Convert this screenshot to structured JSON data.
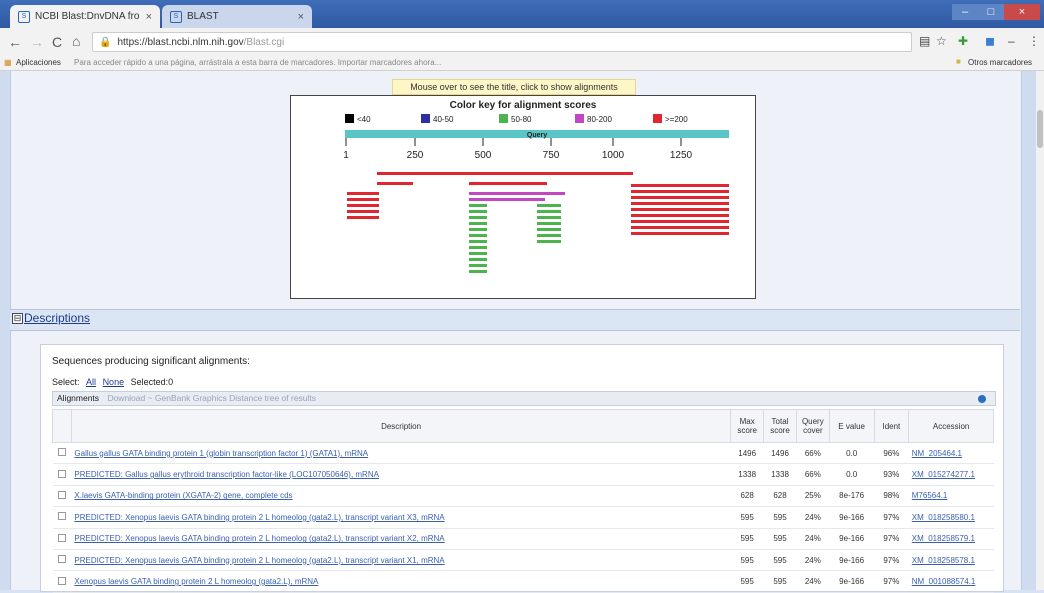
{
  "browser": {
    "tabs": [
      {
        "label": "NCBI Blast:DnvDNA fro"
      },
      {
        "label": "BLAST"
      }
    ],
    "url": "https://blast.ncbi.nlm.nih.gov",
    "url_path": "/Blast.cgi",
    "bookmarks_label": "Aplicaciones",
    "bookmarks_hint": "Para acceder rápido a una página, arrástrala a esta barra de marcadores. Importar marcadores ahora...",
    "other_bookmarks": "Otros marcadores"
  },
  "graphic": {
    "hint": "Mouse over to see the title, click to show alignments",
    "color_key_title": "Color key for alignment scores",
    "key": [
      {
        "label": "<40",
        "color": "#000000"
      },
      {
        "label": "40-50",
        "color": "#2e2ea0"
      },
      {
        "label": "50-80",
        "color": "#4db34d"
      },
      {
        "label": "80-200",
        "color": "#c347c3"
      },
      {
        "label": ">=200",
        "color": "#e0262e"
      }
    ],
    "query_label": "Query",
    "query_color": "#5bc4c4",
    "ticks": [
      "1",
      "250",
      "500",
      "750",
      "1000",
      "1250"
    ]
  },
  "descriptions": {
    "header": "Descriptions",
    "toggle": "⊟",
    "seq_title": "Sequences producing significant alignments:",
    "select_label": "Select:",
    "all_label": "All",
    "none_label": "None",
    "selected_label": "Selected:0",
    "alignments_label": "Alignments",
    "download_label": "Download ~ GenBank Graphics Distance tree of results",
    "columns": [
      "Description",
      "Max score",
      "Total score",
      "Query cover",
      "E value",
      "Ident",
      "Accession"
    ]
  },
  "rows": [
    {
      "desc": "Gallus gallus GATA binding protein 1 (globin transcription factor 1) (GATA1), mRNA",
      "max": "1496",
      "total": "1496",
      "cover": "66%",
      "evalue": "0.0",
      "ident": "96%",
      "acc": "NM_205464.1"
    },
    {
      "desc": "PREDICTED: Gallus gallus erythroid transcription factor-like (LOC107050646), mRNA",
      "max": "1338",
      "total": "1338",
      "cover": "66%",
      "evalue": "0.0",
      "ident": "93%",
      "acc": "XM_015274277.1"
    },
    {
      "desc": "X.laevis GATA-binding protein (XGATA-2) gene, complete cds",
      "max": "628",
      "total": "628",
      "cover": "25%",
      "evalue": "8e-176",
      "ident": "98%",
      "acc": "M76564.1"
    },
    {
      "desc": "PREDICTED: Xenopus laevis GATA binding protein 2 L homeolog (gata2.L), transcript variant X3, mRNA",
      "max": "595",
      "total": "595",
      "cover": "24%",
      "evalue": "9e-166",
      "ident": "97%",
      "acc": "XM_018258580.1"
    },
    {
      "desc": "PREDICTED: Xenopus laevis GATA binding protein 2 L homeolog (gata2.L), transcript variant X2, mRNA",
      "max": "595",
      "total": "595",
      "cover": "24%",
      "evalue": "9e-166",
      "ident": "97%",
      "acc": "XM_018258579.1"
    },
    {
      "desc": "PREDICTED: Xenopus laevis GATA binding protein 2 L homeolog (gata2.L), transcript variant X1, mRNA",
      "max": "595",
      "total": "595",
      "cover": "24%",
      "evalue": "9e-166",
      "ident": "97%",
      "acc": "XM_018258578.1"
    },
    {
      "desc": "Xenopus laevis GATA binding protein 2 L homeolog (gata2.L), mRNA",
      "max": "595",
      "total": "595",
      "cover": "24%",
      "evalue": "9e-166",
      "ident": "97%",
      "acc": "NM_001088574.1"
    }
  ]
}
